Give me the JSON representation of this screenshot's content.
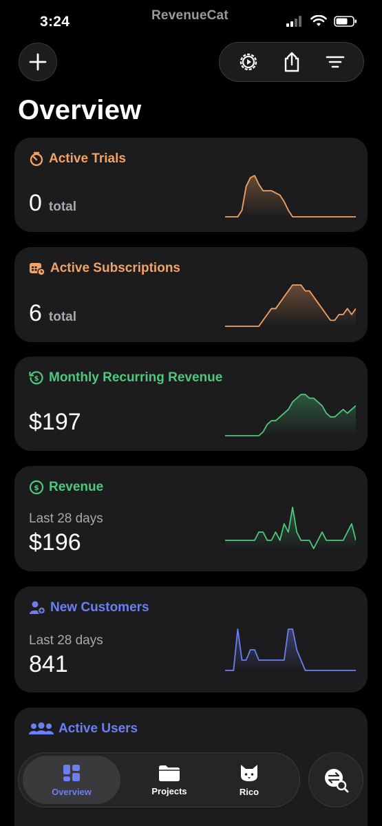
{
  "status_bar": {
    "time": "3:24",
    "brand": "RevenueCat"
  },
  "header": {
    "title": "Overview"
  },
  "icons": {
    "add": "plus-icon",
    "settings": "gear-icon",
    "share": "share-icon",
    "filter": "filter-icon"
  },
  "cards": [
    {
      "title": "Active Trials",
      "value": "0",
      "unit": "total",
      "subtitle": "",
      "color": "#f2a364",
      "icon": "timer-icon",
      "series": [
        0,
        0,
        0,
        0,
        3,
        14,
        18,
        19,
        15,
        12,
        12,
        12,
        11,
        10,
        7,
        3,
        0,
        0,
        0,
        0,
        0,
        0,
        0,
        0,
        0,
        0,
        0,
        0,
        0,
        0,
        0,
        0
      ]
    },
    {
      "title": "Active Subscriptions",
      "value": "6",
      "unit": "total",
      "subtitle": "",
      "color": "#f2a364",
      "icon": "calendar-icon",
      "series": [
        1,
        1,
        1,
        1,
        1,
        1,
        1,
        1,
        1,
        2,
        3,
        4,
        4,
        5,
        6,
        7,
        8,
        8,
        8,
        7,
        7,
        6,
        5,
        4,
        3,
        2,
        2,
        3,
        3,
        4,
        3,
        4
      ]
    },
    {
      "title": "Monthly Recurring Revenue",
      "value": "$197",
      "unit": "",
      "subtitle": "",
      "color": "#4cc97a",
      "icon": "refresh-dollar-icon",
      "series": [
        0,
        0,
        0,
        0,
        0,
        0,
        0,
        0,
        0,
        1,
        3,
        4,
        4,
        5,
        6,
        7,
        9,
        10,
        11,
        11,
        10,
        10,
        9,
        8,
        6,
        5,
        5,
        6,
        7,
        6,
        7,
        8
      ]
    },
    {
      "title": "Revenue",
      "value": "$196",
      "unit": "",
      "subtitle": "Last 28 days",
      "color": "#4cc97a",
      "icon": "dollar-circle-icon",
      "series": [
        0,
        0,
        0,
        0,
        0,
        0,
        0,
        0,
        1,
        1,
        0,
        0,
        1,
        0,
        2,
        1,
        4,
        1,
        0,
        0,
        0,
        -1,
        0,
        1,
        0,
        0,
        0,
        0,
        0,
        1,
        2,
        0
      ]
    },
    {
      "title": "New Customers",
      "value": "841",
      "unit": "",
      "subtitle": "Last 28 days",
      "color": "#6b7ff2",
      "icon": "add-user-icon",
      "series": [
        0,
        0,
        0,
        4,
        1,
        1,
        2,
        2,
        1,
        1,
        1,
        1,
        1,
        1,
        1,
        4,
        4,
        2,
        1,
        0,
        0,
        0,
        0,
        0,
        0,
        0,
        0,
        0,
        0,
        0,
        0,
        0
      ]
    },
    {
      "title": "Active Users",
      "value": "",
      "unit": "",
      "subtitle": "",
      "color": "#6b7ff2",
      "icon": "users-icon",
      "series": []
    }
  ],
  "tabs": [
    {
      "label": "Overview",
      "icon": "dashboard-icon",
      "active": true
    },
    {
      "label": "Projects",
      "icon": "folder-icon",
      "active": false
    },
    {
      "label": "Rico",
      "icon": "cat-icon",
      "active": false
    }
  ],
  "fab": {
    "icon": "search-transactions-icon"
  }
}
